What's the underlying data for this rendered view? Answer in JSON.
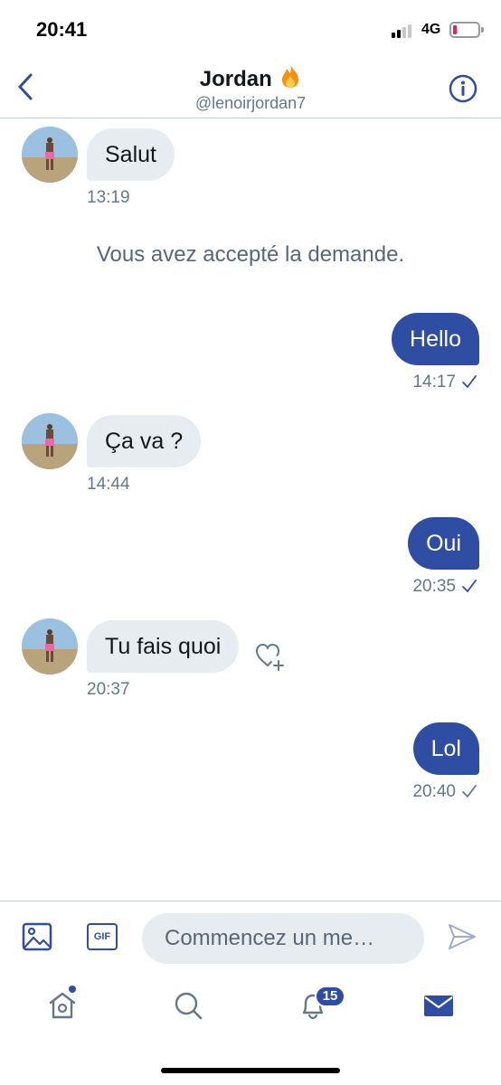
{
  "status_bar": {
    "time": "20:41",
    "network": "4G",
    "battery_color": "#e0245e"
  },
  "header": {
    "name": "Jordan",
    "name_emoji": "fire-icon",
    "handle": "@lenoirjordan7",
    "back_icon": "chevron-left-icon",
    "info_icon": "info-icon"
  },
  "messages": [
    {
      "direction": "in",
      "text": "Salut",
      "time": "13:19"
    },
    {
      "direction": "in",
      "text": "Ça va ?",
      "time": "14:44"
    },
    {
      "direction": "out",
      "text": "Hello",
      "time": "14:17",
      "status": "sent-check-icon"
    },
    {
      "direction": "out",
      "text": "Oui",
      "time": "20:35",
      "status": "sent-check-icon"
    },
    {
      "direction": "in",
      "text": "Tu fais quoi",
      "time": "20:37",
      "reaction_icon": "heart-plus-icon"
    },
    {
      "direction": "out",
      "text": "Lol",
      "time": "20:40",
      "status": "sent-check-icon"
    }
  ],
  "notice": "Vous avez accepté la demande.",
  "composer": {
    "placeholder": "Commencez un me…",
    "gif_label": "GIF",
    "image_icon": "image-icon",
    "send_icon": "send-icon"
  },
  "tabbar": {
    "home_icon": "home-icon",
    "search_icon": "search-icon",
    "notifications_icon": "bell-icon",
    "notifications_count": "15",
    "messages_icon": "mail-icon"
  },
  "colors": {
    "accent": "#2f4da3",
    "incoming_bubble": "#e6ecf0",
    "secondary_text": "#657786"
  }
}
